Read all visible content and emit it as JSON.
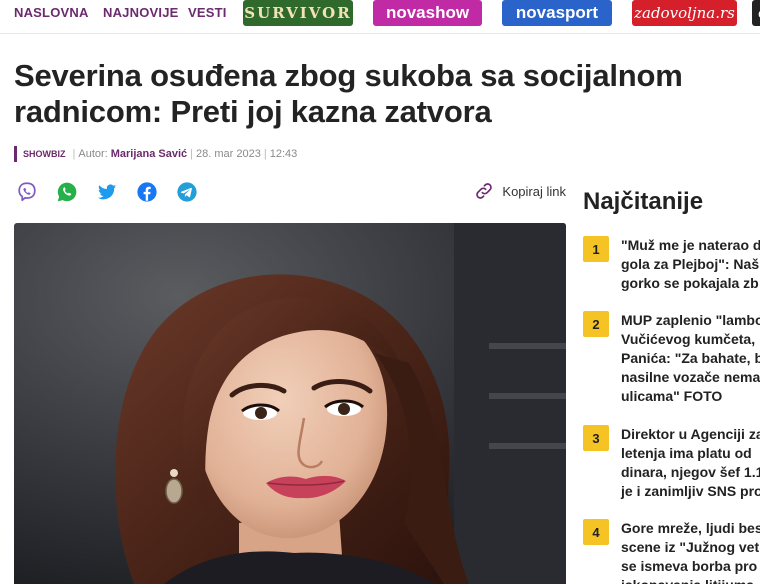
{
  "nav": {
    "links": [
      "NASLOVNA",
      "NAJNOVIJE",
      "VESTI"
    ],
    "brands": [
      "SURVIVOR",
      "novashow",
      "novasport",
      "zadovoljna.rs",
      "e"
    ]
  },
  "article": {
    "title": "Severina osuđena zbog sukoba sa socijalnom radnicom: Preti joj kazna zatvora",
    "section": "SHOWBIZ",
    "author_label": "Autor:",
    "author": "Marijana Savić",
    "date": "28. mar 2023",
    "time": "12:43"
  },
  "share": {
    "icons": [
      "viber-icon",
      "whatsapp-icon",
      "twitter-icon",
      "facebook-icon",
      "telegram-icon"
    ],
    "copy_label": "Kopiraj link"
  },
  "sidebar": {
    "title": "Najčitanije",
    "items": [
      {
        "num": "1",
        "lines": [
          "\"Muž me je naterao d",
          "gola za Plejboj\": Naš",
          "gorko se pokajala zb"
        ]
      },
      {
        "num": "2",
        "lines": [
          "MUP zaplenio \"lambo",
          "Vučićevog kumčeta, ",
          "Panića: \"Za bahate, b",
          "nasilne vozače nema",
          "ulicama\" FOTO"
        ]
      },
      {
        "num": "3",
        "lines": [
          "Direktor u Agenciji za",
          "letenja ima platu od",
          "dinara, njegov šef 1.1",
          "je i zanimljiv SNS pro"
        ]
      },
      {
        "num": "4",
        "lines": [
          "Gore mreže, ljudi bes",
          "scene iz \"Južnog vetr",
          "se ismeva borba pro",
          "iskopavanja litijuma"
        ]
      }
    ]
  },
  "colors": {
    "brand": "#6b2a6d",
    "rank_badge": "#f5c323",
    "survivor": "#2f6a2c",
    "novashow": "#c02aa4",
    "novasport": "#2a63c9",
    "zadovoljna": "#d5202c"
  }
}
